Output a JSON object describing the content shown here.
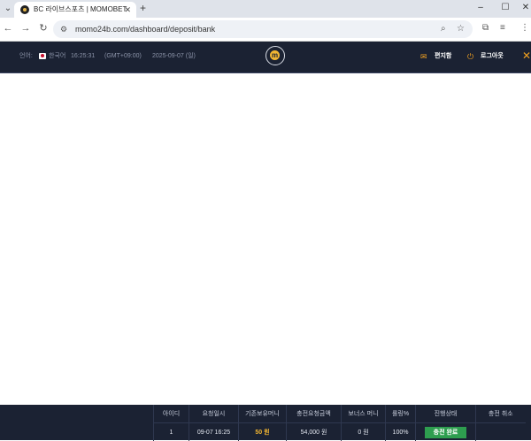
{
  "browser": {
    "tab_title": "BC 라이브스포츠 | MOMOBET",
    "new_tab": "+",
    "url": "momo24b.com/dashboard/deposit/bank",
    "window": {
      "minimize": "–",
      "maximize": "☐",
      "close": "✕"
    }
  },
  "header": {
    "language_label": "언어:",
    "language": "한국어",
    "time": "16:25:31",
    "timezone": "(GMT+09:00)",
    "date": "2025-09-07 (일)",
    "logo_letter": "m",
    "mailbox_label": "편지함",
    "logout_label": "로그아웃",
    "close_symbol": "✕"
  },
  "deposit_history": {
    "columns": [
      "아이디",
      "요청일시",
      "기존보유머니",
      "충전요청금액",
      "보너스 머니",
      "롤링%",
      "진행상태",
      "충전 취소"
    ],
    "rows": [
      {
        "id": "1",
        "requested_at": "09-07 16:25",
        "existing_balance": "50 원",
        "requested_amount": "54,000 원",
        "bonus": "0 원",
        "rolling": "100%",
        "status": "충전 완료",
        "cancel": ""
      }
    ]
  },
  "colors": {
    "header_bg": "#1b2233",
    "accent": "#f2b632",
    "status_complete": "#2e9e4f"
  }
}
